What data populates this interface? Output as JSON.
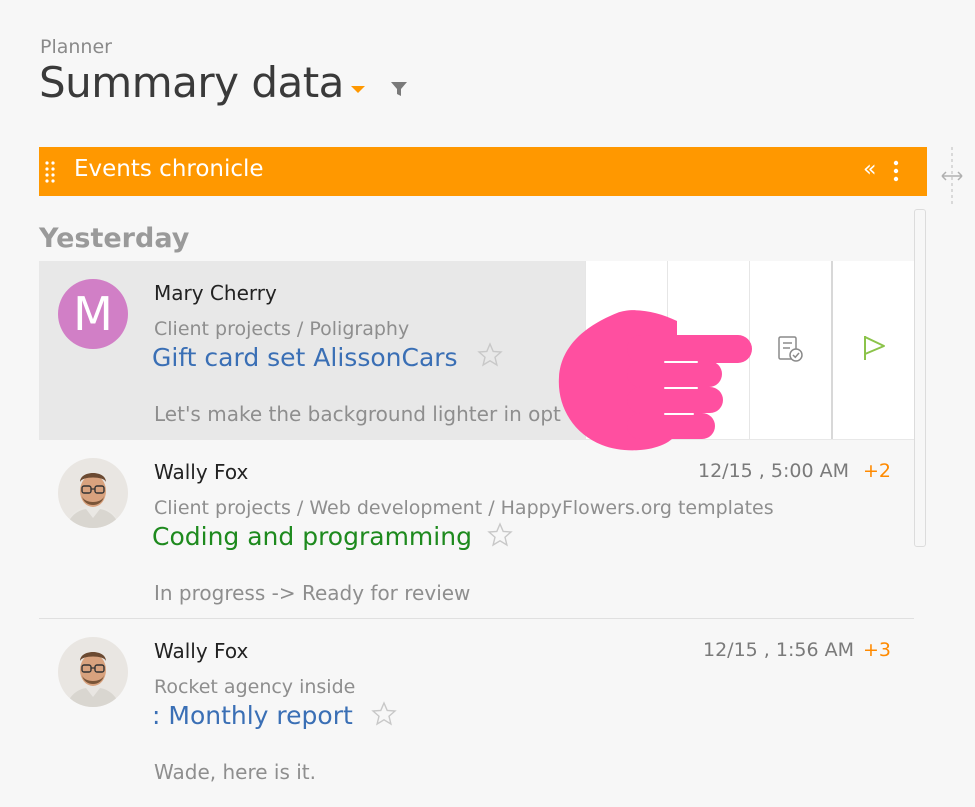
{
  "header": {
    "breadcrumb": "Planner",
    "title": "Summary data"
  },
  "panel": {
    "title": "Events chronicle",
    "collapse_glyph": "«"
  },
  "feed": {
    "section": "Yesterday",
    "items": [
      {
        "avatar_letter": "M",
        "author": "Mary Cherry",
        "path": "Client projects / Poligraphy",
        "subject": "Gift card set AlissonCars",
        "comment": "Let's make the background lighter in opt",
        "date": "",
        "extra": ""
      },
      {
        "author": "Wally Fox",
        "path": "Client projects / Web development / HappyFlowers.org templates",
        "subject": "Coding and programming",
        "comment": "In progress -> Ready for review",
        "date": "12/15 , 5:00 AM",
        "extra": "+2"
      },
      {
        "author": "Wally Fox",
        "path": "Rocket agency inside",
        "subject": ": Monthly report",
        "comment": "Wade, here is it.",
        "date": "12/15 , 1:56 AM",
        "extra": "+3"
      }
    ]
  },
  "colors": {
    "accent": "#ff9800",
    "link": "#3a6fb5",
    "green_link": "#1e8a1e",
    "hand": "#ff4fa0",
    "avatar_m": "#d17fc6"
  },
  "icons": [
    "filter-icon",
    "grip-icon",
    "collapse-icon",
    "more-icon",
    "resize-icon",
    "star-icon",
    "checklist-icon",
    "flag-icon",
    "pointer-hand-icon"
  ]
}
